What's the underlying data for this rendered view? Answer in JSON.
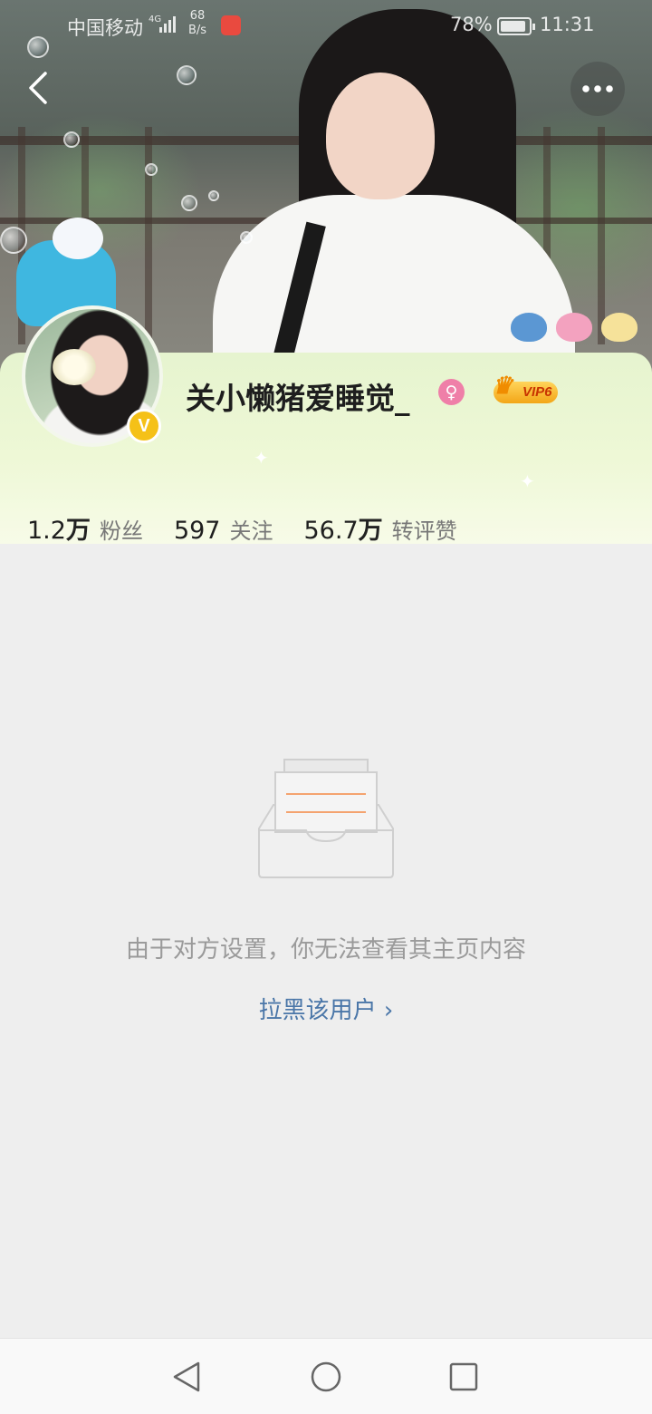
{
  "status_bar": {
    "carrier": "中国移动",
    "network": "4G",
    "speed_value": "68",
    "speed_unit": "B/s",
    "battery_percent": "78%",
    "time": "11:31"
  },
  "header": {
    "back_icon": "chevron-left-icon",
    "more_icon": "more-horizontal-icon"
  },
  "profile": {
    "username": "关小懒猪爱睡觉_",
    "gender": "female",
    "verified": true,
    "verified_badge": "V",
    "vip_label": "VIP6",
    "stats": [
      {
        "num": "1.2",
        "unit": "万",
        "label": "粉丝"
      },
      {
        "num": "597",
        "unit": "",
        "label": "关注"
      },
      {
        "num": "56.7",
        "unit": "万",
        "label": "转评赞"
      }
    ]
  },
  "empty_state": {
    "icon": "empty-inbox-icon",
    "message": "由于对方设置，你无法查看其主页内容",
    "block_link": "拉黑该用户 ›"
  },
  "colors": {
    "accent_link": "#4a76a8",
    "card_gradient_top": "#e6f4cf",
    "vip_gold": "#f3a617",
    "verified_yellow": "#f5c118",
    "gender_pink": "#ef7fa8"
  },
  "navbar": {
    "back": "triangle-back-icon",
    "home": "circle-home-icon",
    "recents": "square-recents-icon"
  }
}
